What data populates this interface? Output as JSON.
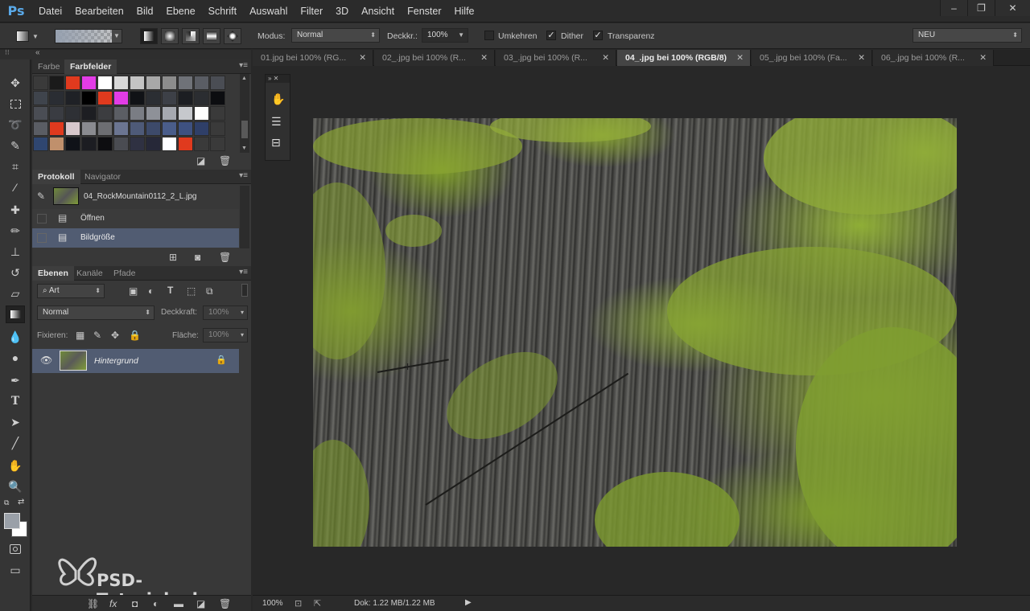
{
  "app": {
    "logo": "Ps"
  },
  "menu": [
    "Datei",
    "Bearbeiten",
    "Bild",
    "Ebene",
    "Schrift",
    "Auswahl",
    "Filter",
    "3D",
    "Ansicht",
    "Fenster",
    "Hilfe"
  ],
  "window_controls": {
    "minimize": "–",
    "restore": "❐",
    "close": "✕"
  },
  "options": {
    "modus_label": "Modus:",
    "modus_value": "Normal",
    "deckkraft_label": "Deckkr.:",
    "deckkraft_value": "100%",
    "umkehren_label": "Umkehren",
    "dither_label": "Dither",
    "transparenz_label": "Transparenz",
    "workspace_value": "NEU",
    "umkehren_checked": false,
    "dither_checked": true,
    "transparenz_checked": true
  },
  "color_panel": {
    "tabs": [
      "Farbe",
      "Farbfelder"
    ],
    "active_tab": "Farbfelder",
    "swatches": [
      [
        "#3a3a3a",
        "#1a1a1a",
        "#e03a1e",
        "#e23ce6",
        "#ffffff",
        "#d8d8d8",
        "#c4c4c4",
        "#a8a8a8",
        "#8c8c8c",
        "#6f7278",
        "#5a5d64",
        "#4a4d54"
      ],
      [
        "#3f444c",
        "#2a2d33",
        "#1f2126",
        "#000000",
        "#e03a1e",
        "#e23ce6",
        "#101216",
        "#2b2e33",
        "#3d4047",
        "#1c1e22",
        "#2b2d31",
        "#0c0d10"
      ],
      [
        "#4a4d54",
        "#3a3c42",
        "#2e3035",
        "#1d1e22",
        "#3c3d40",
        "#5b5e64",
        "#7a7d84",
        "#8e9198",
        "#a6a9b0",
        "#c6c8cc",
        "#ffffff",
        "#3a3a3a"
      ],
      [
        "#5a5d64",
        "#e03a1e",
        "#d8c8cc",
        "#8a8b90",
        "#6d6e72",
        "#6b7591",
        "#4e5a78",
        "#3d4a6a",
        "#4a5d8a",
        "#3e5180",
        "#2f3f68",
        "#3a3a3a"
      ],
      [
        "#2f4670",
        "#c0906c",
        "#101218",
        "#1c1d22",
        "#0d0d10",
        "#4a4c52",
        "#2f3142",
        "#262838",
        "#ffffff",
        "#e03a1e",
        "#3a3a3a",
        "#3a3a3a"
      ]
    ]
  },
  "history_panel": {
    "tabs": [
      "Protokoll",
      "Navigator"
    ],
    "active_tab": "Protokoll",
    "snapshot": "04_RockMountain0112_2_L.jpg",
    "items": [
      "Öffnen",
      "Bildgröße"
    ]
  },
  "layers_panel": {
    "tabs": [
      "Ebenen",
      "Kanäle",
      "Pfade"
    ],
    "active_tab": "Ebenen",
    "filter_kind": "Art",
    "blend_mode": "Normal",
    "opacity_label": "Deckkraft:",
    "opacity_value": "100%",
    "lock_label": "Fixieren:",
    "fill_label": "Fläche:",
    "fill_value": "100%",
    "layers": [
      {
        "name": "Hintergrund",
        "visible": true,
        "locked": true
      }
    ]
  },
  "document_tabs": [
    {
      "label": "01.jpg bei 100% (RG...",
      "active": false
    },
    {
      "label": "02_.jpg bei 100% (R...",
      "active": false
    },
    {
      "label": "03_.jpg bei 100% (R...",
      "active": false
    },
    {
      "label": "04_.jpg bei 100% (RGB/8)",
      "active": true
    },
    {
      "label": "05_.jpg bei 100% (Fa...",
      "active": false
    },
    {
      "label": "06_.jpg bei 100% (R...",
      "active": false
    }
  ],
  "status": {
    "zoom": "100%",
    "doc_size": "Dok: 1.22 MB/1.22 MB"
  },
  "watermark": "PSD-Tutorials.de",
  "colors": {
    "accent": "#5aa9e8",
    "selected_row": "#515c72",
    "foreground": "#9aa0a8",
    "background": "#ffffff"
  }
}
